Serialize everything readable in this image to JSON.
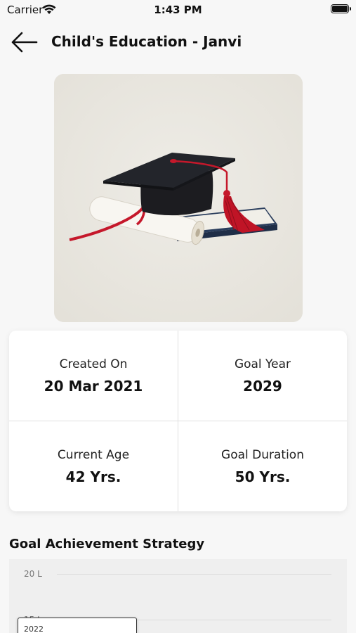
{
  "status_bar": {
    "carrier": "Carrier",
    "time": "1:43 PM"
  },
  "header": {
    "title": "Child's Education - Janvi"
  },
  "summary": {
    "created_on_label": "Created On",
    "created_on_value": "20 Mar 2021",
    "goal_year_label": "Goal Year",
    "goal_year_value": "2029",
    "current_age_label": "Current Age",
    "current_age_value": "42 Yrs.",
    "goal_duration_label": "Goal Duration",
    "goal_duration_value": "50 Yrs."
  },
  "strategy": {
    "title": "Goal Achievement Strategy",
    "y_ticks": [
      "20 L",
      "15 L"
    ],
    "tooltip_year": "2022"
  }
}
